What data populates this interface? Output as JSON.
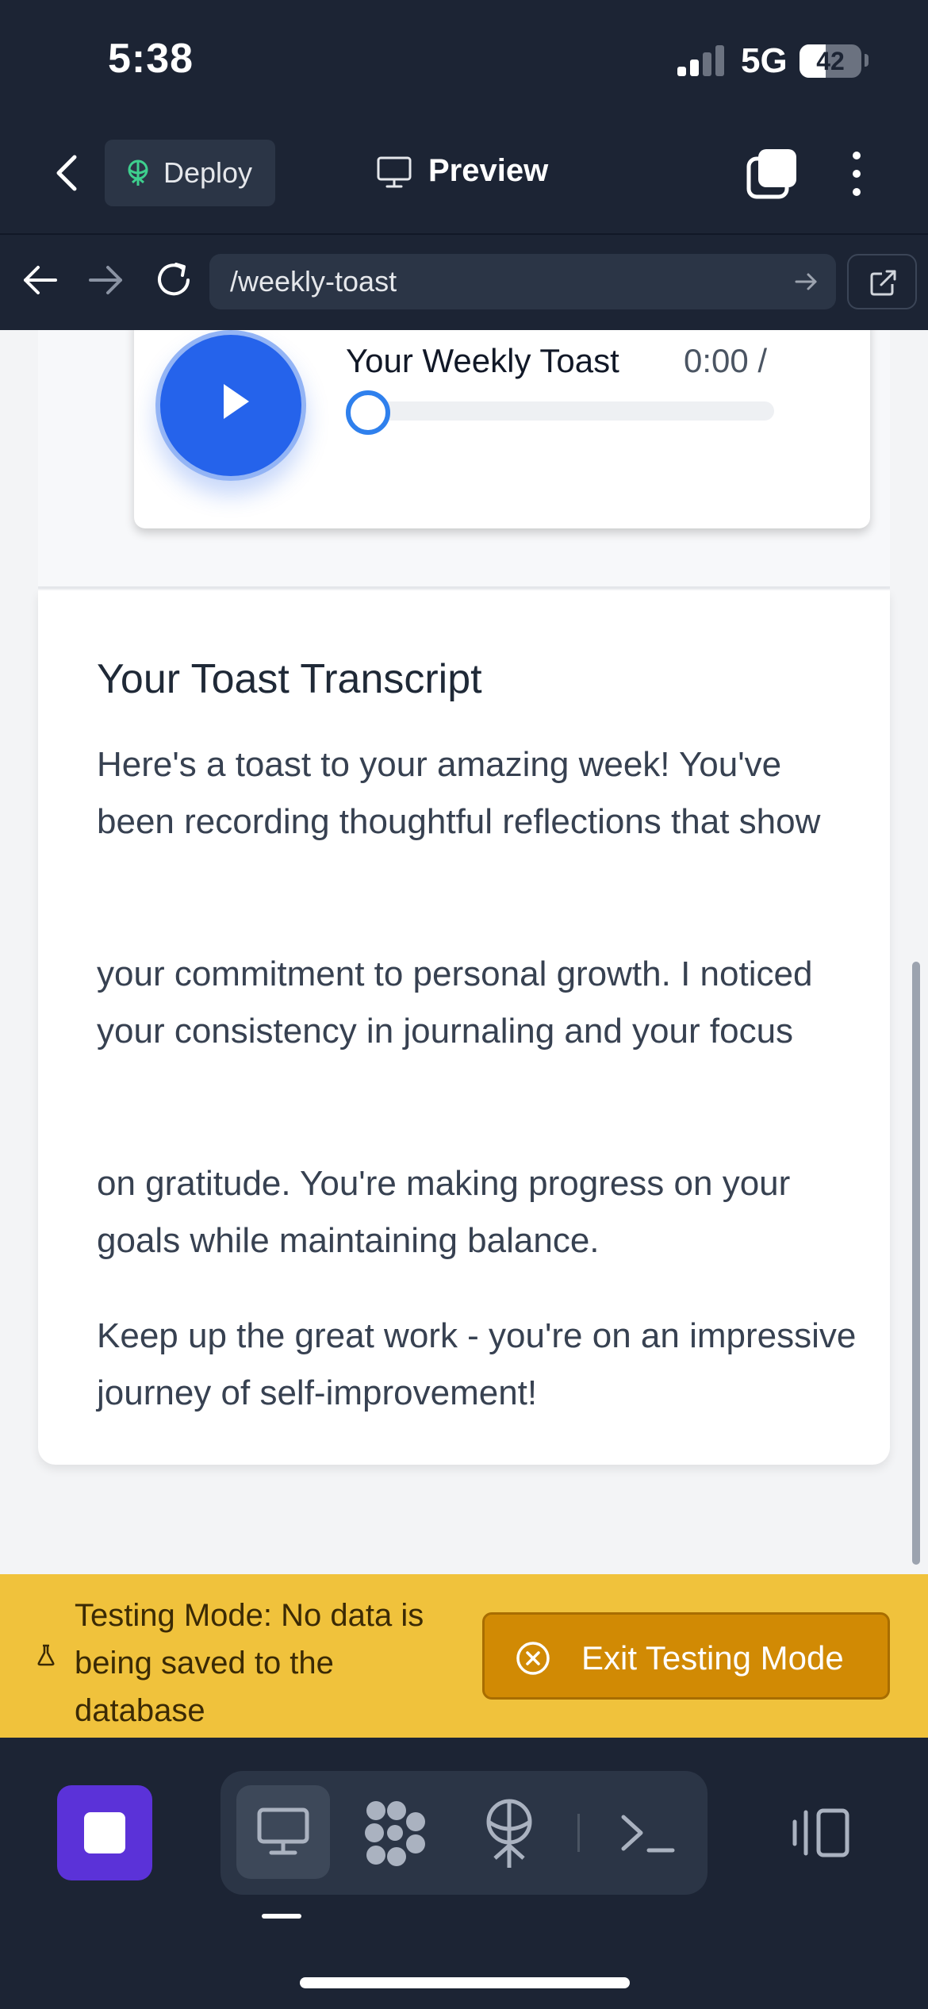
{
  "status_bar": {
    "time": "5:38",
    "network": "5G",
    "battery_level": "42",
    "battery_fraction": 0.42,
    "signal_bars_active": 2,
    "signal_bars_total": 4
  },
  "top_bar": {
    "deploy_label": "Deploy",
    "preview_label": "Preview",
    "icons": [
      "chevron-left-icon",
      "deploy-icon",
      "monitor-icon",
      "tabs-icon",
      "more-vertical-icon"
    ]
  },
  "browser_bar": {
    "url": "/weekly-toast",
    "icons": [
      "arrow-left-icon",
      "arrow-right-icon",
      "reload-icon",
      "go-arrow-icon",
      "external-link-icon"
    ]
  },
  "player": {
    "title": "Your Weekly Toast",
    "time": "0:00 /",
    "progress_fraction": 0.0,
    "icon": "play-icon"
  },
  "transcript": {
    "title": "Your Toast Transcript",
    "paragraphs": [
      "Here's a toast to your amazing week! You've been recording thoughtful reflections that show",
      "your commitment to personal growth. I noticed your consistency in journaling and your focus",
      "on gratitude. You're making progress on your goals while maintaining balance.",
      "Keep up the great work - you're on an impressive journey of self-improvement!"
    ]
  },
  "testing_banner": {
    "message": "Testing Mode: No data is being saved to the database",
    "exit_label": "Exit Testing Mode",
    "icons": [
      "flask-icon",
      "close-circle-icon"
    ]
  },
  "bottom_bar": {
    "icons": [
      "app-icon",
      "desktop-icon",
      "modules-icon",
      "deploy-icon",
      "terminal-icon",
      "layout-toggle-icon"
    ]
  },
  "colors": {
    "app_bg": "#1c2434",
    "accent_blue": "#2563eb",
    "banner_yellow": "#f0c23c",
    "exit_button": "#d18a04",
    "app_purple": "#5b32d8"
  }
}
